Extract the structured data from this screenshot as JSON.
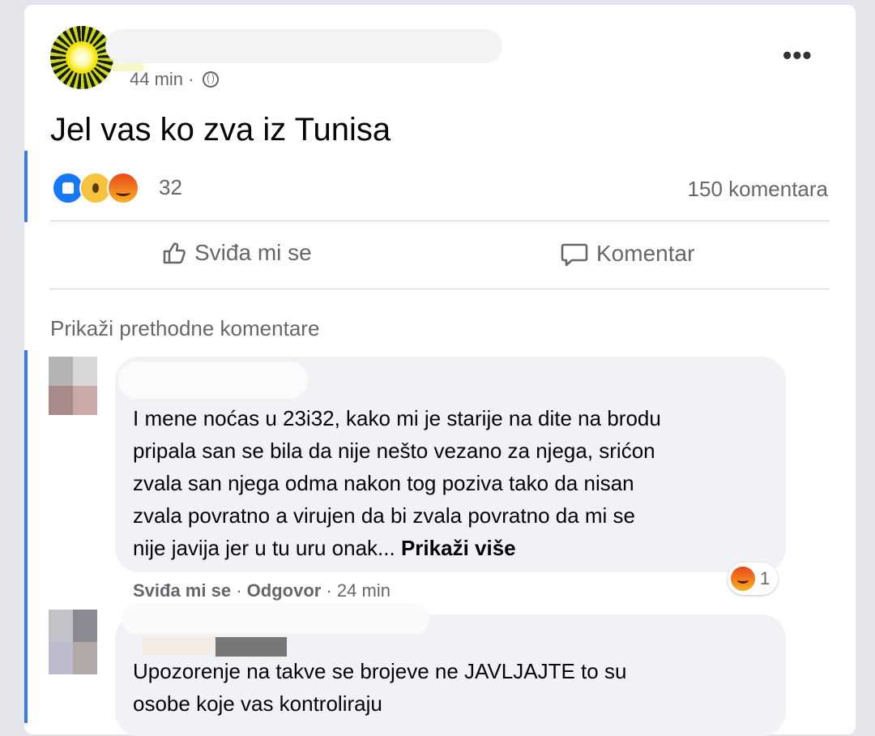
{
  "post": {
    "time": "44 min",
    "separator": "·",
    "privacy_icon": "globe-icon",
    "more_icon": "more-dots-icon",
    "more_label": "•••",
    "text": "Jel vas ko zva iz Tunisa",
    "reactions": {
      "icons": [
        "like-reaction-icon",
        "wow-reaction-icon",
        "angry-reaction-icon"
      ],
      "count": "32"
    },
    "comments_count": "150 komentara"
  },
  "actions": {
    "like_label": "Sviđa mi se",
    "comment_label": "Komentar"
  },
  "show_previous": "Prikaži prethodne komentare",
  "comments": [
    {
      "text": "I mene noćas u 23i32, kako mi je starije na dite na brodu\npripala san se bila da nije nešto vezano za njega, srićon\nzvala san njega odma nakon tog poziva tako da nisan\nzvala povratno a virujen da bi zvala povratno da mi se\nnije javija jer u tu uru onak...",
      "see_more": "Prikaži više",
      "like": "Sviđa mi se",
      "reply": "Odgovor",
      "time": "24 min",
      "reaction_count": "1"
    },
    {
      "text": "Upozorenje na takve se brojeve ne JAVLJAJTE to su\nosobe koje vas kontroliraju"
    }
  ],
  "colors": {
    "page_bg": "#e4e6eb",
    "card_bg": "#ffffff",
    "bubble_bg": "#f0f2f5",
    "secondary_text": "#65676b",
    "accent_blue": "#1877f2"
  }
}
